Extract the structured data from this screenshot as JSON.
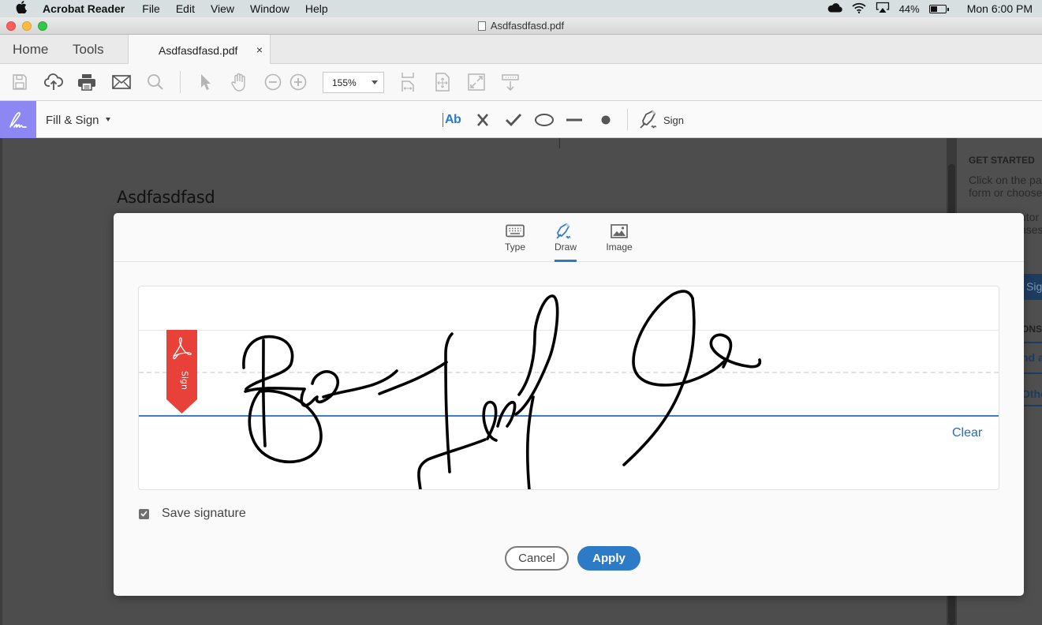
{
  "menubar": {
    "app_name": "Acrobat Reader",
    "items": [
      "File",
      "Edit",
      "View",
      "Window",
      "Help"
    ],
    "status": {
      "battery_percent": "44%",
      "clock": "Mon 6:00 PM",
      "icons": [
        "cloud-icon",
        "wifi-icon",
        "airplay-icon",
        "battery-icon"
      ]
    }
  },
  "window": {
    "title": "Asdfasdfasd.pdf"
  },
  "tabbar": {
    "home_label": "Home",
    "tools_label": "Tools",
    "document_tab": "Asdfasdfasd.pdf",
    "close_glyph": "×"
  },
  "toolbar": {
    "icons": [
      "save-icon",
      "upload-icon",
      "print-icon",
      "email-icon",
      "search-icon",
      "select-pointer-icon",
      "hand-icon",
      "zoom-out-icon",
      "zoom-in-icon",
      "fit-width-icon",
      "fit-page-icon",
      "full-screen-icon",
      "read-mode-icon"
    ],
    "zoom_level": "155%"
  },
  "fill_sign": {
    "title": "Fill & Sign",
    "tools": [
      "add-text-icon",
      "cross-mark-icon",
      "check-mark-icon",
      "ellipse-icon",
      "line-icon",
      "dot-icon"
    ],
    "add_text_label": "Ab",
    "sign_label": "Sign"
  },
  "document": {
    "heading": "Asdfasdfasd"
  },
  "right_panel": {
    "section_heading": "GET STARTED",
    "text_line1": "Click on the pa",
    "text_line2": "form or choose",
    "text_line3": "utor",
    "text_line4": "nses",
    "sign_button": "Sig",
    "section2_heading": "ONS",
    "link1": "nd a",
    "link2": "Othe"
  },
  "dialog": {
    "tabs": [
      {
        "label": "Type",
        "icon": "keyboard-icon",
        "active": false
      },
      {
        "label": "Draw",
        "icon": "pen-icon",
        "active": true
      },
      {
        "label": "Image",
        "icon": "image-icon",
        "active": false
      }
    ],
    "flag_label": "Sign",
    "clear_label": "Clear",
    "save_signature_label": "Save signature",
    "save_signature_checked": true,
    "cancel_label": "Cancel",
    "apply_label": "Apply"
  },
  "colors": {
    "accent_blue": "#2d7ac6",
    "fill_sign_purple": "#8c87f2",
    "sign_flag_red": "#e8413a",
    "baseline_blue": "#3d7dc4"
  }
}
